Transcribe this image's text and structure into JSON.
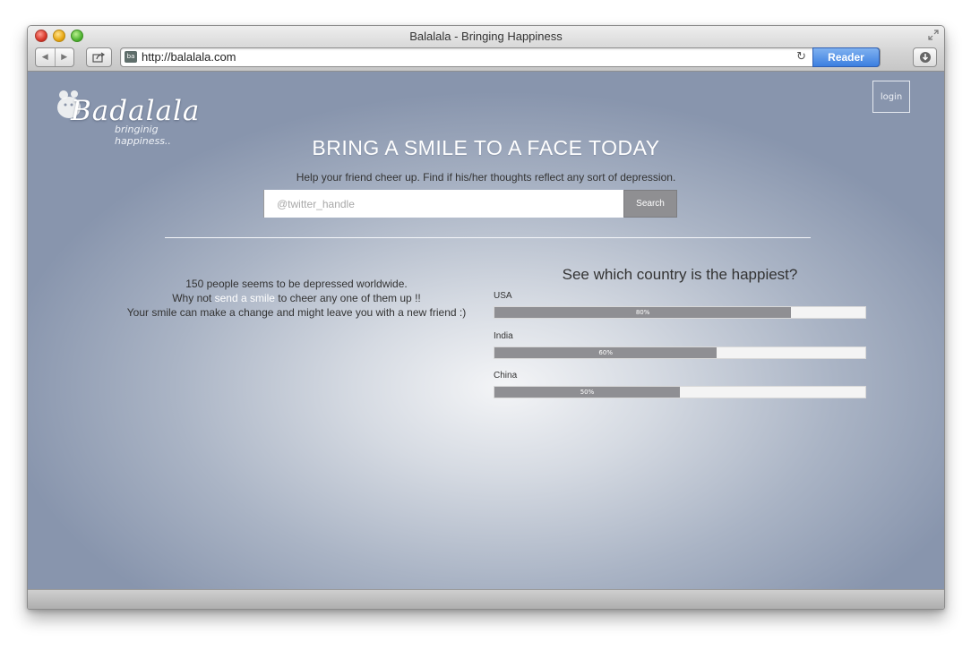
{
  "window": {
    "title": "Balalala - Bringing Happiness",
    "url": "http://balalala.com",
    "reader_label": "Reader",
    "favicon_text": "ba"
  },
  "header": {
    "logo_text": "Badalala",
    "logo_tagline": "bringinig happiness..",
    "login_label": "login"
  },
  "hero": {
    "title": "BRING A SMILE TO A FACE TODAY",
    "subtitle": "Help your friend cheer up. Find if his/her thoughts reflect any sort of depression.",
    "search_placeholder": "@twitter_handle",
    "search_value": "",
    "search_label": "Search"
  },
  "info": {
    "line1": "150 people seems to be depressed worldwide.",
    "line2_prefix": "Why not ",
    "line2_link": "send a smile",
    "line2_suffix": " to cheer any one of them up !!",
    "line3": "Your smile can make a change and might leave you with a new friend :)"
  },
  "happiness": {
    "title": "See which country is the happiest?"
  },
  "chart_data": {
    "type": "bar",
    "title": "See which country is the happiest?",
    "orientation": "horizontal",
    "categories": [
      "USA",
      "India",
      "China"
    ],
    "values": [
      80,
      60,
      50
    ],
    "value_labels": [
      "80%",
      "60%",
      "50%"
    ],
    "ylim": [
      0,
      100
    ],
    "colors": {
      "fill": "#8f8f93",
      "track": "#f4f4f4"
    }
  }
}
